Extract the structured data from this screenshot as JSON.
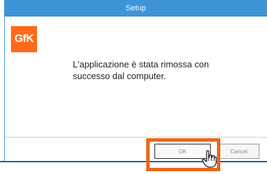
{
  "window": {
    "title": "Setup"
  },
  "logo": {
    "text": "GfK"
  },
  "message": {
    "line1": "L'applicazione è stata rimossa con",
    "line2": "successo dal computer."
  },
  "buttons": {
    "primary_label": "OK",
    "secondary_label": "Cancel"
  },
  "colors": {
    "titlebar": "#3d95d8",
    "logo": "#ff6a1a",
    "highlight": "#e8681f"
  },
  "icons": {
    "cursor": "hand-pointer-icon"
  }
}
